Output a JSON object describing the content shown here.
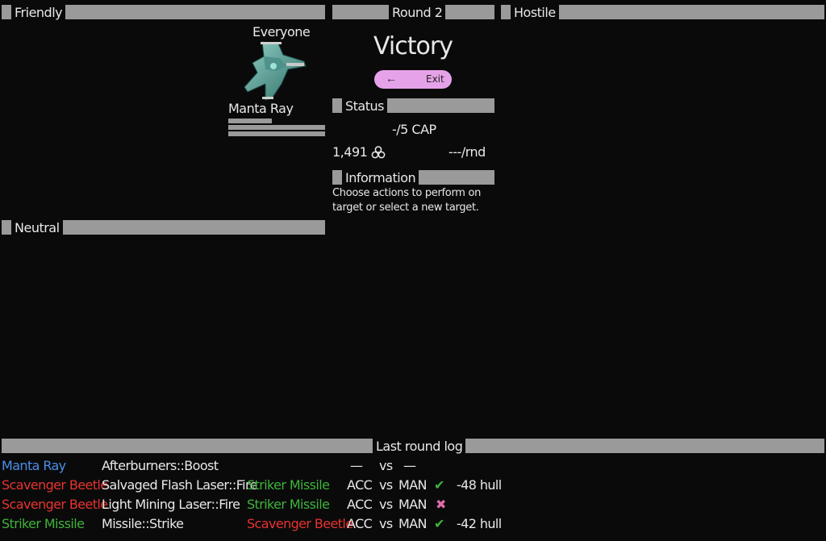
{
  "panels": {
    "friendly": "Friendly",
    "round": "Round 2",
    "hostile": "Hostile",
    "neutral": "Neutral",
    "status": "Status",
    "information": "Information",
    "log": "Last round log"
  },
  "ship": {
    "owner": "Everyone",
    "name": "Manta Ray",
    "hull_fraction": 0.45,
    "bar2_fraction": 1.0,
    "bar3_fraction": 1.0
  },
  "result": {
    "title": "Victory",
    "exit_label": "Exit",
    "exit_arrow": "←"
  },
  "status": {
    "cap": "-/5 CAP",
    "credits": "1,491",
    "credits_icon": "credits-icon",
    "rate": "---/rnd"
  },
  "information": {
    "text": "Choose actions to perform on target or select a new target."
  },
  "log": [
    {
      "actor": "Manta Ray",
      "actor_color": "blue",
      "action": "Afterburners::Boost",
      "target": "",
      "target_color": "",
      "att": "—",
      "vs": "vs",
      "def": "—",
      "hit": "",
      "result": ""
    },
    {
      "actor": "Scavenger Beetle",
      "actor_color": "red",
      "action": "Salvaged Flash Laser::Fire",
      "target": "Striker Missile",
      "target_color": "green",
      "att": "ACC",
      "vs": "vs",
      "def": "MAN",
      "hit": "check",
      "result": "-48 hull"
    },
    {
      "actor": "Scavenger Beetle",
      "actor_color": "red",
      "action": "Light Mining Laser::Fire",
      "target": "Striker Missile",
      "target_color": "green",
      "att": "ACC",
      "vs": "vs",
      "def": "MAN",
      "hit": "cross",
      "result": ""
    },
    {
      "actor": "Striker Missile",
      "actor_color": "green",
      "action": "Missile::Strike",
      "target": "Scavenger Beetle",
      "target_color": "red",
      "att": "ACC",
      "vs": "vs",
      "def": "MAN",
      "hit": "check",
      "result": "-42 hull"
    }
  ]
}
